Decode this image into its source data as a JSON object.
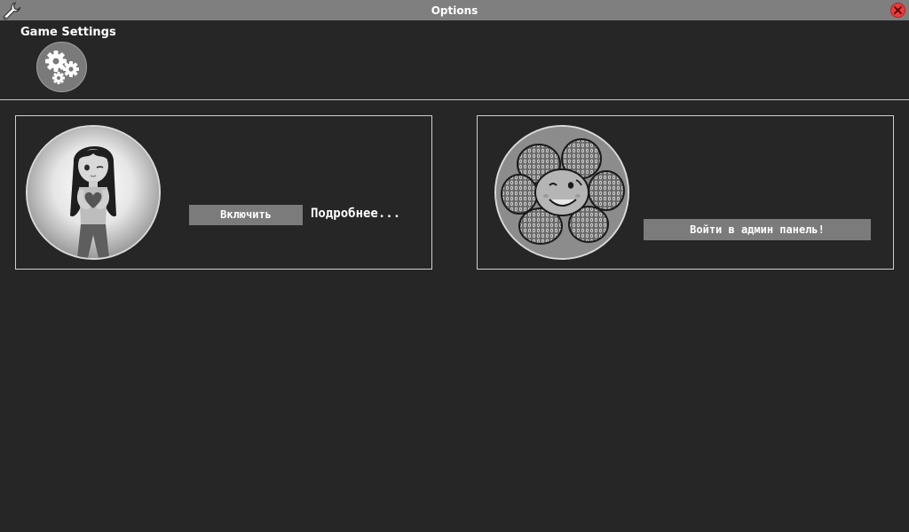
{
  "window": {
    "title": "Options",
    "title_icon": "wrench-icon",
    "close_icon": "close-icon",
    "close_color": "#ee3b3b"
  },
  "game_settings": {
    "label": "Game Settings",
    "icon": "gears-icon"
  },
  "panels": [
    {
      "avatar": "girl-character-portrait",
      "button_label": "Включить",
      "link_label": "Подробнее..."
    },
    {
      "avatar": "flower-character-portrait",
      "button_label": "Войти в админ панель!"
    }
  ],
  "colors": {
    "background": "#262626",
    "title_bar": "#7f7f7f",
    "button": "#7b7b7b",
    "text": "#ffffff"
  }
}
